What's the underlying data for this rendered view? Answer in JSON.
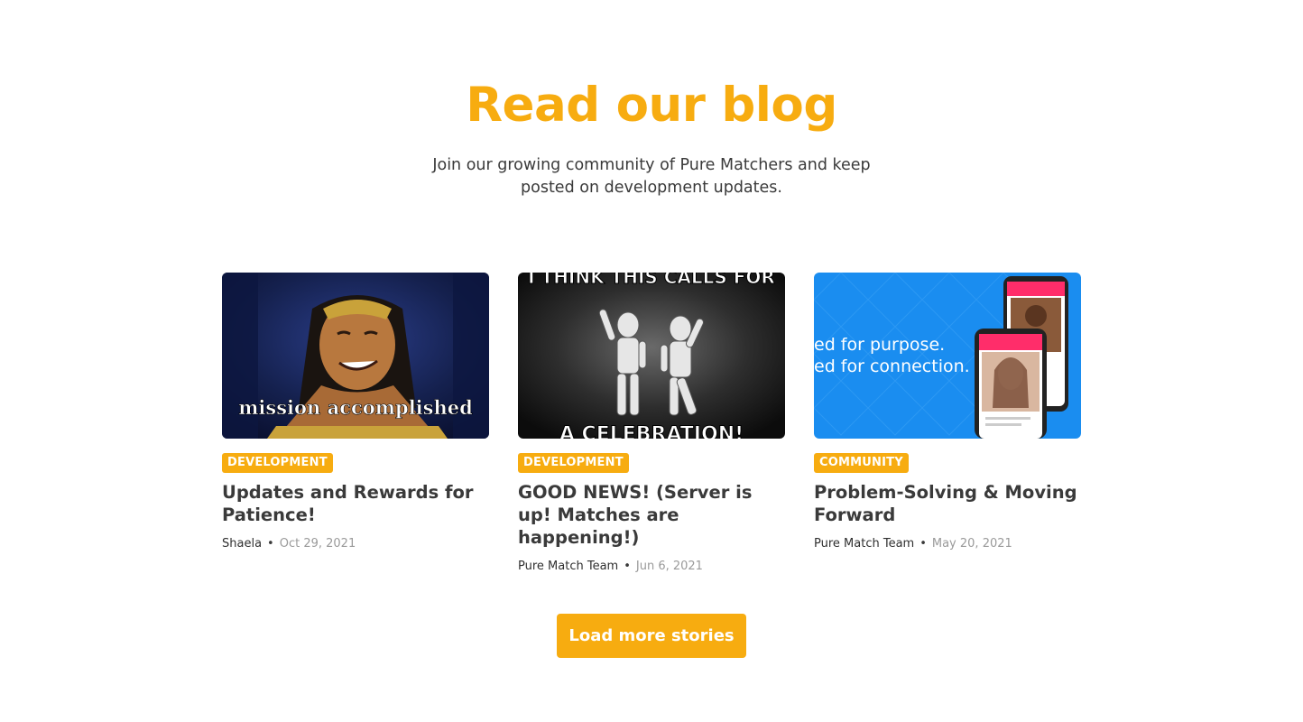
{
  "section": {
    "title": "Read our blog",
    "subtitle": "Join our growing community of Pure Matchers and keep posted on development updates."
  },
  "posts": [
    {
      "category": "DEVELOPMENT",
      "title": "Updates and Rewards for Patience!",
      "author": "Shaela",
      "date": "Oct 29, 2021",
      "image_caption": "mission accomplished"
    },
    {
      "category": "DEVELOPMENT",
      "title": "GOOD NEWS! (Server is up! Matches are happening!)",
      "author": "Pure Match Team",
      "date": "Jun 6, 2021",
      "image_caption_top": "I THINK THIS CALLS FOR",
      "image_caption_bottom": "A CELEBRATION!"
    },
    {
      "category": "COMMUNITY",
      "title": "Problem-Solving & Moving Forward",
      "author": "Pure Match Team",
      "date": "May 20, 2021",
      "image_text_line1": "ed for purpose.",
      "image_text_line2": "ed for connection."
    }
  ],
  "meta_separator": "•",
  "load_more_label": "Load more stories",
  "colors": {
    "accent": "#f7ac10",
    "text": "#3a3a3a",
    "muted": "#9a9a9a"
  }
}
